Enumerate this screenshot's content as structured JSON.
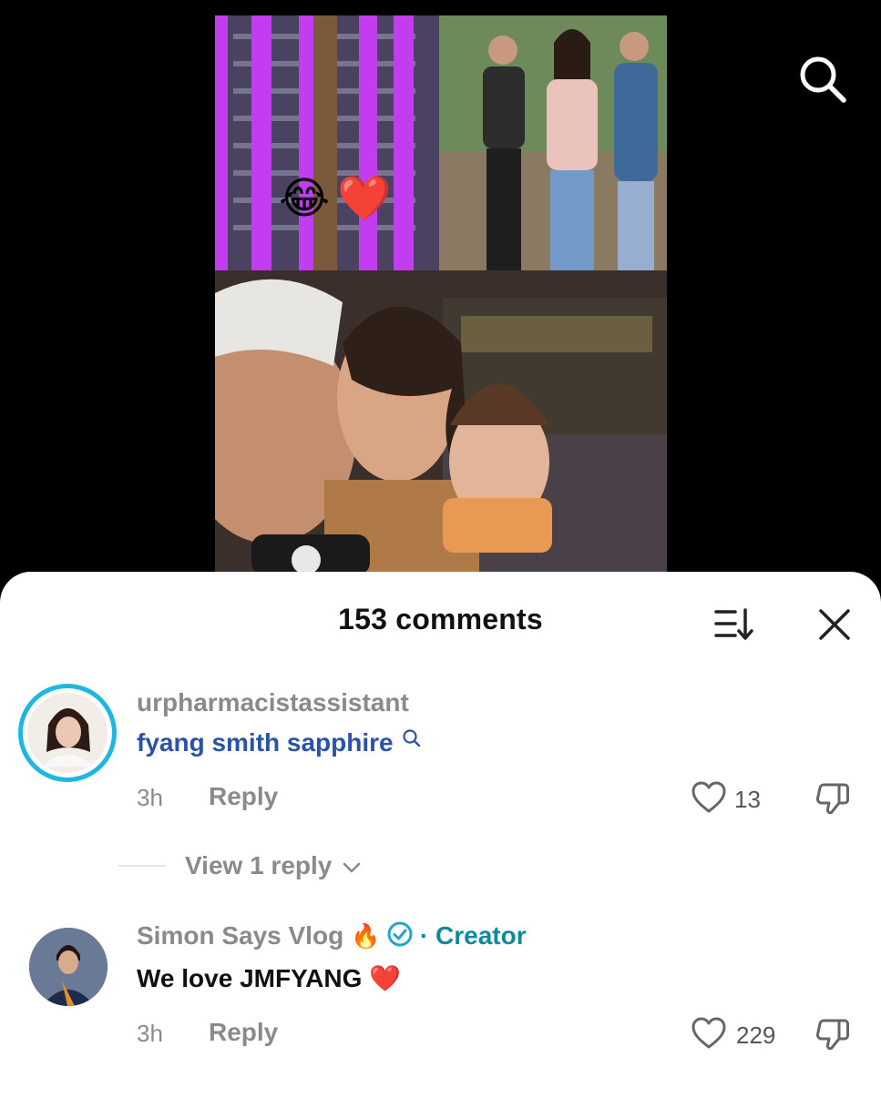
{
  "video": {
    "overlay_emojis": [
      "😂",
      "❤️"
    ],
    "search_icon": "search-icon"
  },
  "comments_sheet": {
    "title": "153 comments",
    "sort_icon": "sort-icon",
    "close_icon": "close-icon",
    "comments": [
      {
        "username": "urpharmacistassistant",
        "text": "fyang smith sapphire",
        "text_color": "#2a53a8",
        "search_icon": "search-icon",
        "time": "3h",
        "reply_label": "Reply",
        "likes": "13",
        "avatar_ring_color": "#1fb7e0"
      },
      {
        "username": "Simon Says Vlog",
        "username_emoji": "🔥",
        "verified_icon": "verified-check-icon",
        "separator": "·",
        "creator_label": "Creator",
        "creator_color": "#0e8a9e",
        "text": "We love JMFYANG",
        "text_emoji": "❤️",
        "time": "3h",
        "reply_label": "Reply",
        "likes": "229"
      }
    ],
    "view_replies_label": "View 1 reply"
  }
}
